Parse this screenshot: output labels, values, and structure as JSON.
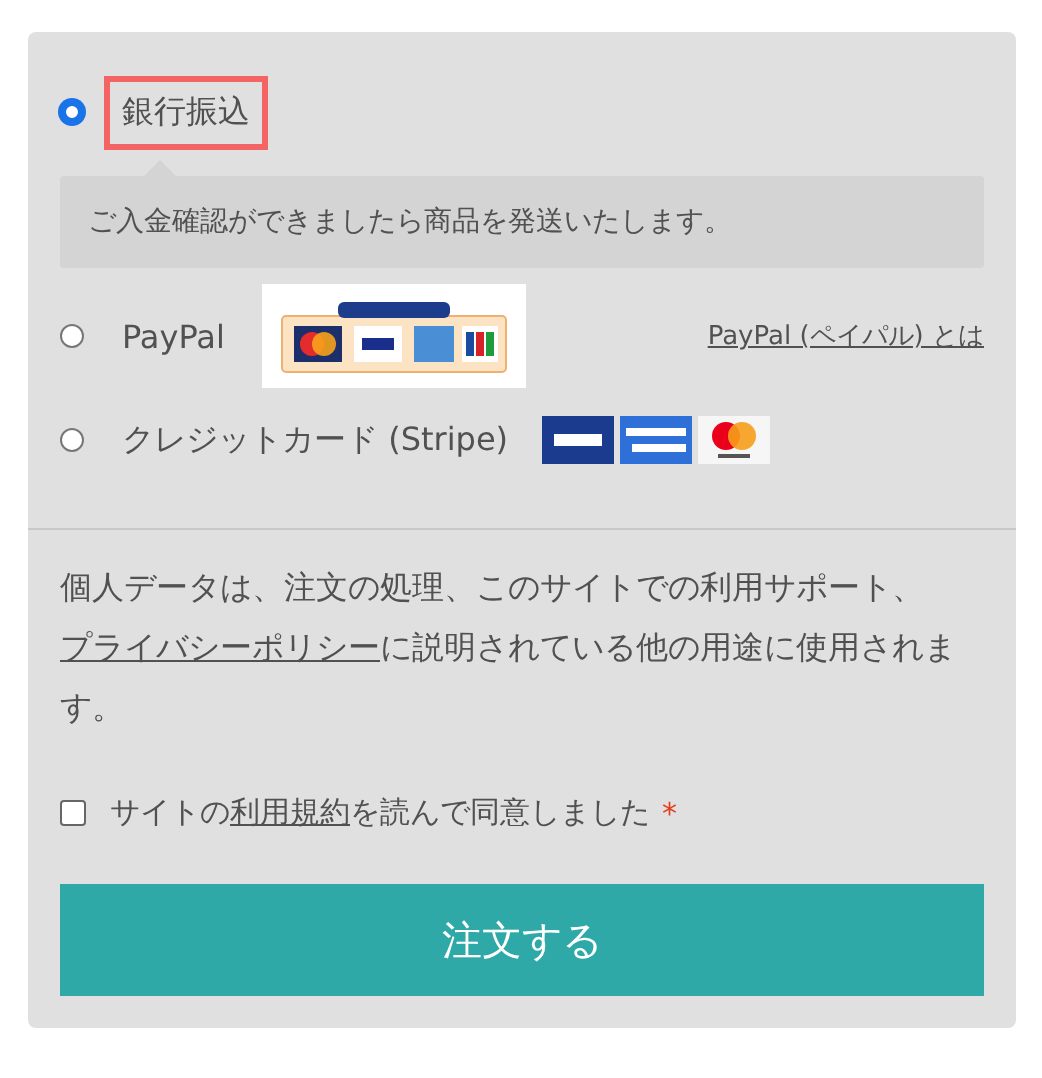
{
  "payment_methods": [
    {
      "kind": "bank",
      "label": "銀行振込",
      "selected": true,
      "highlighted": true,
      "description": "ご入金確認ができましたら商品を発送いたします。"
    },
    {
      "kind": "paypal",
      "label": "PayPal",
      "selected": false,
      "highlighted": false,
      "link": "PayPal (ペイパル) とは"
    },
    {
      "kind": "card",
      "label": "クレジットカード (Stripe)",
      "selected": false,
      "highlighted": false
    }
  ],
  "privacy": {
    "before": "個人データは、注文の処理、このサイトでの利用サポート、",
    "link": "プライバシーポリシー",
    "after": "に説明されている他の用途に使用されます。"
  },
  "terms": {
    "checked": false,
    "before": "サイトの",
    "link": "利用規約",
    "after": "を読んで同意しました",
    "required": "*"
  },
  "place_order": "注文する"
}
